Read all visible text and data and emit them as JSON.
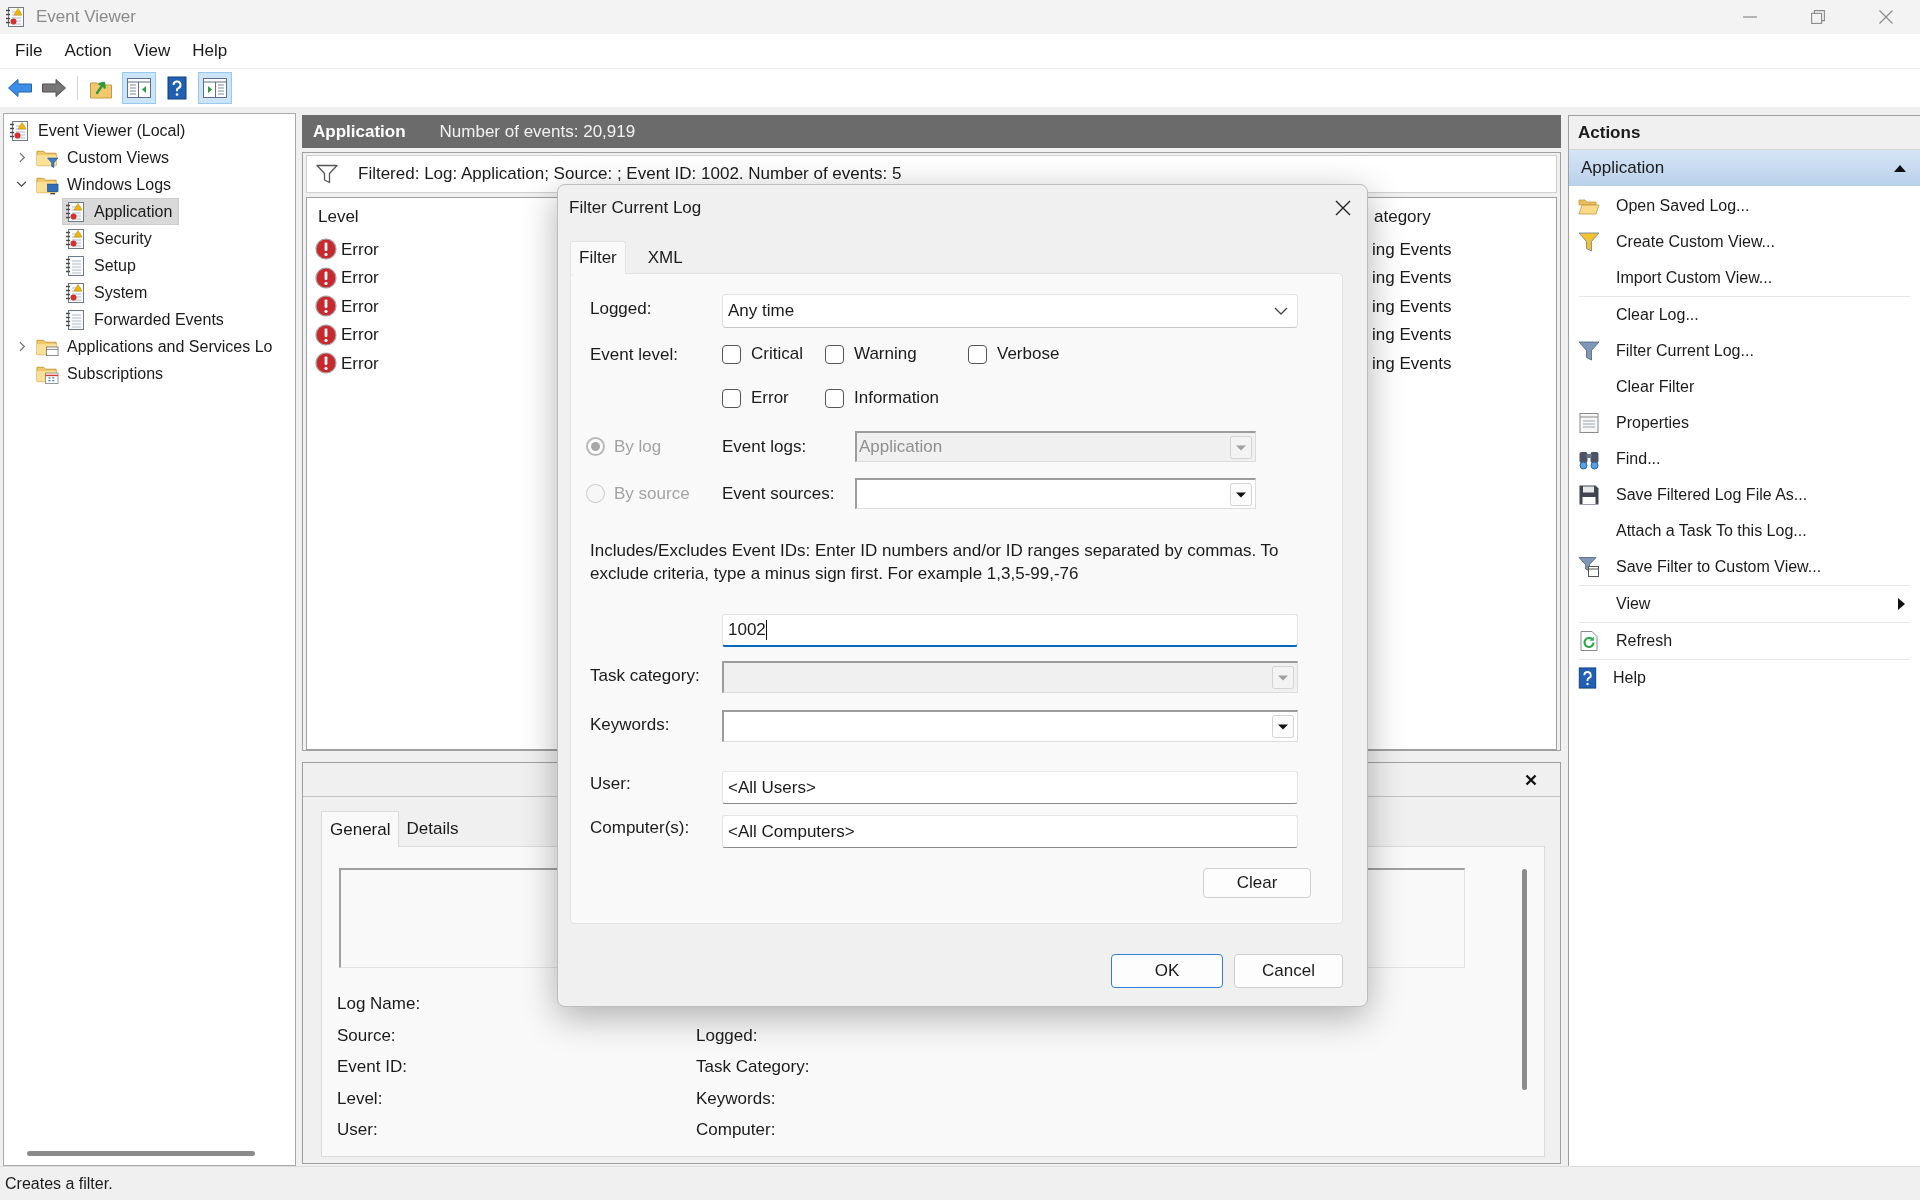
{
  "window": {
    "title": "Event Viewer"
  },
  "menu": [
    "File",
    "Action",
    "View",
    "Help"
  ],
  "toolbar": {
    "groups": [
      [
        {
          "kind": "back",
          "pressed": false,
          "disabled": false
        },
        {
          "kind": "forward",
          "pressed": false,
          "disabled": true
        }
      ],
      [
        {
          "kind": "up",
          "pressed": false,
          "disabled": false
        },
        {
          "kind": "tree",
          "pressed": true,
          "disabled": false
        },
        {
          "kind": "help",
          "pressed": false,
          "disabled": false
        },
        {
          "kind": "actionpane",
          "pressed": true,
          "disabled": false
        }
      ]
    ]
  },
  "tree": [
    {
      "label": "Event Viewer (Local)",
      "kind": "viewer",
      "selected": false,
      "children": [
        {
          "label": "Custom Views",
          "kind": "viewfolder",
          "expanded": false,
          "selected": false
        },
        {
          "label": "Windows Logs",
          "kind": "logfolder",
          "expanded": true,
          "selected": false,
          "children": [
            {
              "label": "Application",
              "kind": "eventlog",
              "selected": true
            },
            {
              "label": "Security",
              "kind": "eventlog",
              "selected": false
            },
            {
              "label": "Setup",
              "kind": "plainlog",
              "selected": false
            },
            {
              "label": "System",
              "kind": "eventlog",
              "selected": false
            },
            {
              "label": "Forwarded Events",
              "kind": "plainlog",
              "selected": false
            }
          ]
        },
        {
          "label": "Applications and Services Lo",
          "kind": "folder",
          "expanded": false,
          "selected": false
        },
        {
          "label": "Subscriptions",
          "kind": "subscriptions",
          "selected": false
        }
      ]
    }
  ],
  "log_header": {
    "title": "Application",
    "count": "Number of events: 20,919"
  },
  "filter_bar": {
    "text": "Filtered: Log: Application; Source: ; Event ID: 1002. Number of events: 5"
  },
  "event_list": {
    "columns": [
      {
        "label": "Level"
      },
      {
        "label": "ategory"
      }
    ],
    "rows": [
      {
        "kind": "error",
        "level": "Error",
        "column_2": "ing Events"
      },
      {
        "kind": "error",
        "level": "Error",
        "column_2": "ing Events"
      },
      {
        "kind": "error",
        "level": "Error",
        "column_2": "ing Events"
      },
      {
        "kind": "error",
        "level": "Error",
        "column_2": "ing Events"
      },
      {
        "kind": "error",
        "level": "Error",
        "column_2": "ing Events"
      }
    ]
  },
  "details": {
    "tabs": [
      {
        "label": "General",
        "selected": true
      },
      {
        "label": "Details",
        "selected": false
      }
    ],
    "rows": [
      [
        "Log Name:"
      ],
      [
        "Source:",
        "Logged:"
      ],
      [
        "Event ID:",
        "Task Category:"
      ],
      [
        "Level:",
        "Keywords:"
      ],
      [
        "User:",
        "Computer:"
      ]
    ]
  },
  "actions": {
    "title": "Actions",
    "section": {
      "label": "Application",
      "expanded": true
    },
    "groups": [
      [
        {
          "kind": "open",
          "label": "Open Saved Log..."
        },
        {
          "kind": "createview",
          "label": "Create Custom View..."
        },
        {
          "kind": "plain",
          "label": "Import Custom View..."
        }
      ],
      [
        {
          "kind": "plain",
          "label": "Clear Log..."
        },
        {
          "kind": "filter",
          "label": "Filter Current Log..."
        },
        {
          "kind": "plain",
          "label": "Clear Filter"
        },
        {
          "kind": "properties",
          "label": "Properties"
        },
        {
          "kind": "find",
          "label": "Find..."
        },
        {
          "kind": "save",
          "label": "Save Filtered Log File As..."
        },
        {
          "kind": "plain",
          "label": "Attach a Task To this Log..."
        },
        {
          "kind": "savefilter",
          "label": "Save Filter to Custom View..."
        }
      ],
      [
        {
          "kind": "submenu",
          "label": "View"
        }
      ],
      [
        {
          "kind": "refresh",
          "label": "Refresh"
        }
      ],
      [
        {
          "kind": "help",
          "label": "Help"
        }
      ]
    ]
  },
  "status_bar": {
    "text": "Creates a filter."
  },
  "dialog": {
    "title": "Filter Current Log",
    "tabs": [
      {
        "label": "Filter",
        "selected": true
      },
      {
        "label": "XML",
        "selected": false
      }
    ],
    "logged": {
      "label": "Logged:",
      "value": "Any time"
    },
    "event_level": {
      "label": "Event level:",
      "options": [
        {
          "label": "Critical",
          "checked": false
        },
        {
          "label": "Warning",
          "checked": false
        },
        {
          "label": "Verbose",
          "checked": false
        },
        {
          "label": "Error",
          "checked": false
        },
        {
          "label": "Information",
          "checked": false
        }
      ]
    },
    "log_source": [
      {
        "label": "By log",
        "selected": true,
        "disabled": true,
        "field_label": "Event logs:",
        "value": "Application",
        "field_disabled": true
      },
      {
        "label": "By source",
        "selected": false,
        "disabled": true,
        "field_label": "Event sources:",
        "field_disabled": false
      }
    ],
    "event_ids": {
      "description": "Includes/Excludes Event IDs: Enter ID numbers and/or ID ranges separated by commas. To exclude criteria, type a minus sign first. For example 1,3,5-99,-76",
      "value": "1002",
      "focused": true
    },
    "task_category": {
      "label": "Task category:",
      "disabled": true
    },
    "keywords": {
      "label": "Keywords:",
      "disabled": false
    },
    "user": {
      "label": "User:",
      "value": "<All Users>"
    },
    "computers": {
      "label": "Computer(s):",
      "value": "<All Computers>"
    },
    "clear_button": "Clear",
    "buttons": [
      {
        "label": "OK",
        "default": true
      },
      {
        "label": "Cancel",
        "default": false
      }
    ]
  }
}
